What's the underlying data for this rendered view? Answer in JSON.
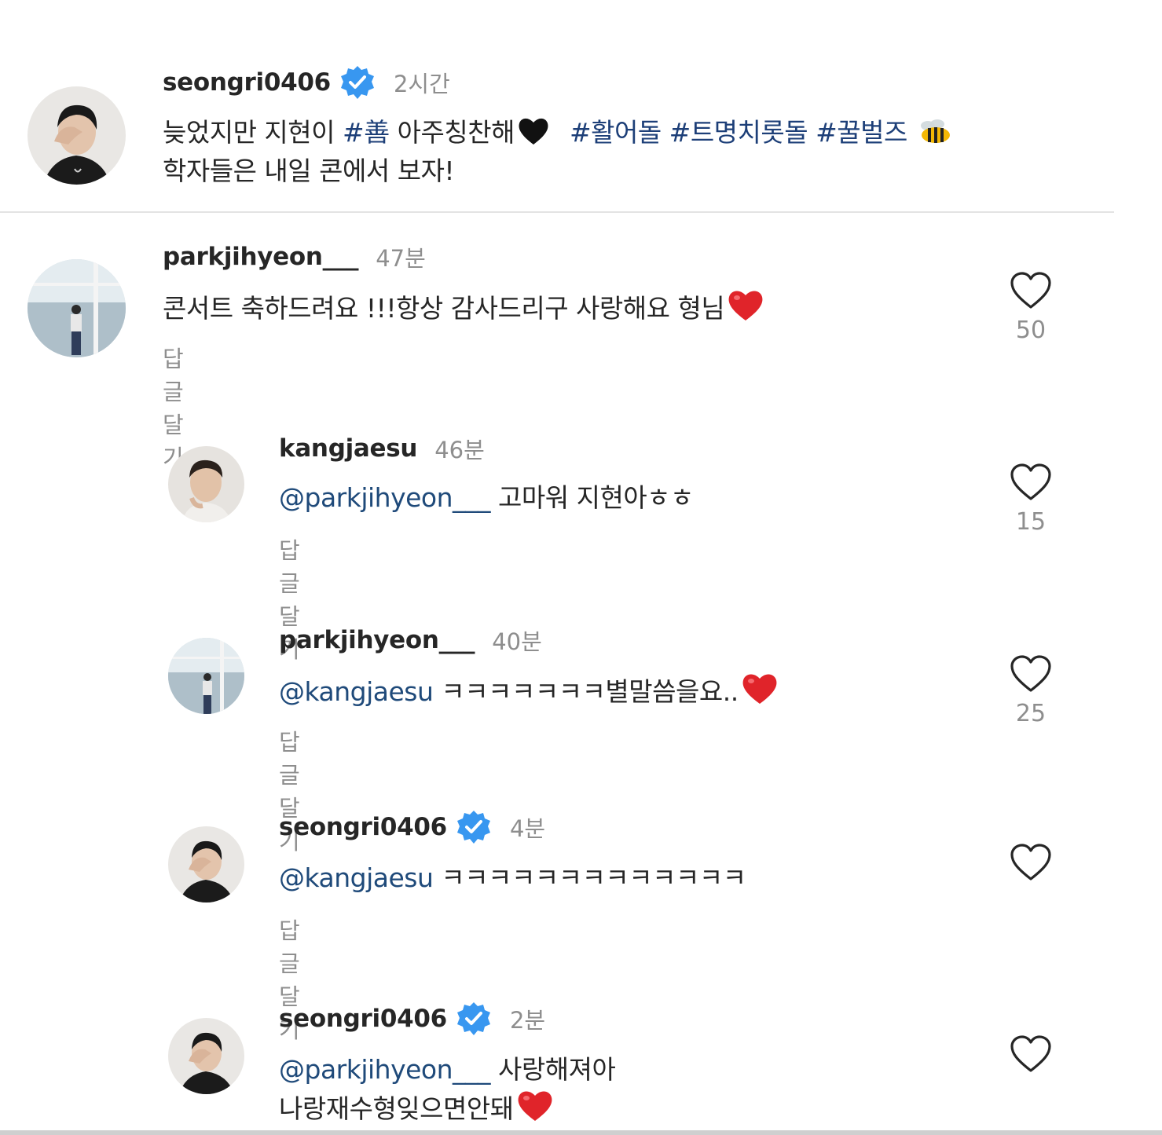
{
  "caption": {
    "username": "seongri0406",
    "verified": true,
    "time": "2시간",
    "line1_text": "늦었지만 지현이 ",
    "line1_hashtag1": "#善",
    "line1_mid": " 아주칭찬해",
    "line1_hashtags2": "#활어돌 #트명치롯돌 #꿀벌즈",
    "line1_emojis": [
      "black-heart",
      "bee"
    ],
    "line2": "학자들은 내일 콘에서 보자!"
  },
  "comments": [
    {
      "username": "parkjihyeon___",
      "time": "47분",
      "text": "콘서트 축하드려요 !!!항상 감사드리구 사랑해요 형님",
      "emoji": "red-heart",
      "reply_label": "답글 달기",
      "likes": "50"
    }
  ],
  "replies": [
    {
      "username": "kangjaesu",
      "time": "46분",
      "mention": "@parkjihyeon___",
      "text": " 고마워 지현아ㅎㅎ",
      "reply_label": "답글 달기",
      "likes": "15"
    },
    {
      "username": "parkjihyeon___",
      "time": "40분",
      "mention": "@kangjaesu",
      "text": " ㅋㅋㅋㅋㅋㅋㅋ별말씀을요..",
      "emoji": "red-heart",
      "reply_label": "답글 달기",
      "likes": "25"
    },
    {
      "username": "seongri0406",
      "verified": true,
      "time": "4분",
      "mention": "@kangjaesu",
      "text": " ㅋㅋㅋㅋㅋㅋㅋㅋㅋㅋㅋㅋㅋ",
      "reply_label": "답글 달기",
      "likes": ""
    },
    {
      "username": "seongri0406",
      "verified": true,
      "time": "2분",
      "mention": "@parkjihyeon___",
      "text": " 사랑해져아",
      "text_line2": "나랑재수형잊으면안돼",
      "emoji": "red-heart",
      "likes": ""
    }
  ],
  "colors": {
    "text": "#262626",
    "secondary": "#8e8e8e",
    "link": "#1d3f78",
    "verified": "#3897f0",
    "heart_red": "#e0242a"
  }
}
